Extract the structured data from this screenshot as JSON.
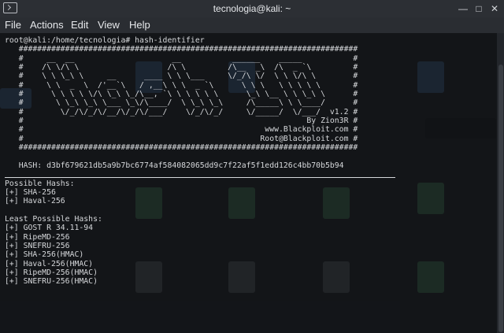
{
  "window": {
    "title": "tecnologia@kali: ~",
    "controls": [
      "minimize-icon",
      "maximize-icon",
      "close-icon"
    ]
  },
  "menu": [
    "File",
    "Actions",
    "Edit",
    "View",
    "Help"
  ],
  "terminal": {
    "lines": [
      "root@kali:/home/tecnologia# hash-identifier",
      "   #########################################################################",
      "   #     __  __                     __           ______    _____           #",
      "   #    /\\ \\/\\ \\                   /\\ \\         /\\__  _\\  /\\  _ `\\         #",
      "   #    \\ \\ \\_\\ \\     __      ____ \\ \\ \\___     \\/_/\\ \\/  \\ \\ \\/\\ \\        #",
      "   #     \\ \\  _  \\  /'__`\\   / ,__\\ \\ \\  _ `\\      \\ \\ \\   \\ \\ \\ \\ \\       #",
      "   #      \\ \\ \\ \\ \\/\\ \\_\\ \\_/\\__, `\\ \\ \\ \\ \\ \\      \\_\\ \\__ \\ \\ \\_\\ \\      #",
      "   #       \\ \\_\\ \\_\\ \\___ \\_\\/\\____/  \\ \\_\\ \\_\\     /\\_____\\ \\ \\____/      #",
      "   #        \\/_/\\/_/\\/__/\\/_/\\/___/    \\/_/\\/_/     \\/_____/  \\/___/  v1.2 #",
      "   #                                                             By Zion3R #",
      "   #                                                    www.Blackploit.com #",
      "   #                                                   Root@Blackploit.com #",
      "   #########################################################################",
      "",
      "   HASH: d3bf679621db5a9b7bc6774af584082065dd9c7f22af5f1edd126c4bb70b5b94",
      "",
      "Possible Hashs:",
      "[+] SHA-256",
      "[+] Haval-256",
      "",
      "Least Possible Hashs:",
      "[+] GOST R 34.11-94",
      "[+] RipeMD-256",
      "[+] SNEFRU-256",
      "[+] SHA-256(HMAC)",
      "[+] Haval-256(HMAC)",
      "[+] RipeMD-256(HMAC)",
      "[+] SNEFRU-256(HMAC)"
    ]
  }
}
